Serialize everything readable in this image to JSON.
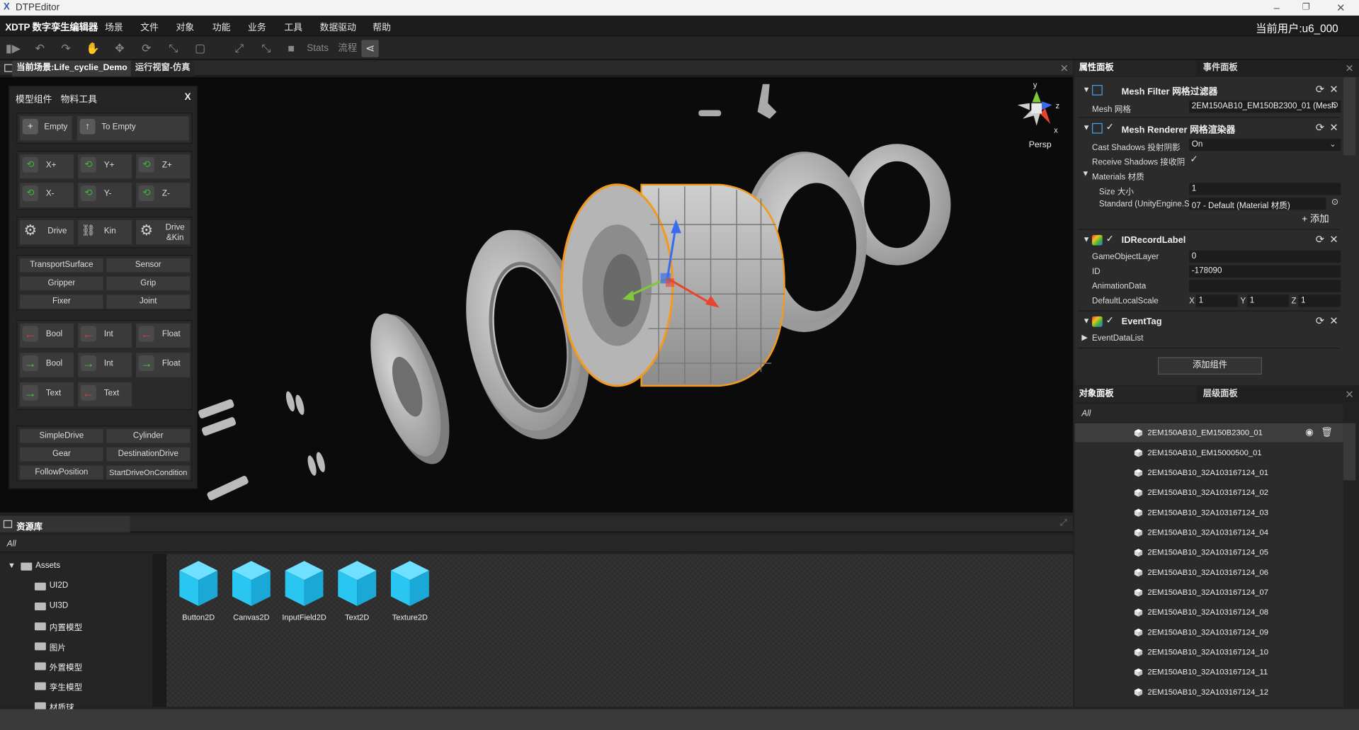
{
  "window": {
    "title": "DTPEditor",
    "logo_text": "X"
  },
  "menubar": {
    "brand": "XDTP 数字孪生编辑器",
    "items": [
      "场景",
      "文件",
      "对象",
      "功能",
      "业务",
      "工具",
      "数据驱动",
      "帮助"
    ],
    "user": "当前用户:u6_000"
  },
  "toolbar": {
    "stats_label": "Stats",
    "flow_label": "流程"
  },
  "scene": {
    "tab_current": "当前场景:Life_cyclie_Demo",
    "tab_runtime": "运行视窗-仿真",
    "view_mode": "Persp",
    "axes": {
      "y": "y",
      "z": "z",
      "x": "x"
    }
  },
  "tool_panel": {
    "tabs": [
      "模型组件",
      "物料工具"
    ],
    "close": "X",
    "empty_buttons": [
      "Empty",
      "To Empty"
    ],
    "axis_buttons": [
      "X+",
      "Y+",
      "Z+",
      "X-",
      "Y-",
      "Z-"
    ],
    "drive_buttons": [
      "Drive",
      "Kin",
      "Drive &Kin"
    ],
    "component_buttons": [
      "TransportSurface",
      "Sensor",
      "Gripper",
      "Grip",
      "Fixer",
      "Joint"
    ],
    "signal_buttons": [
      "Bool",
      "Int",
      "Float",
      "Bool",
      "Int",
      "Float",
      "Text",
      "Text"
    ],
    "drive_types": [
      "SimpleDrive",
      "Cylinder",
      "Gear",
      "DestinationDrive",
      "FollowPosition",
      "StartDriveOnCondition"
    ]
  },
  "properties": {
    "tab_props": "属性面板",
    "tab_events": "事件面板",
    "mesh_filter": {
      "title": "Mesh Filter 网格过滤器",
      "mesh_label": "Mesh 网格",
      "mesh_value": "2EM150AB10_EM150B2300_01 (Mesh"
    },
    "mesh_renderer": {
      "title": "Mesh Renderer 网格渲染器",
      "cast_shadows_label": "Cast Shadows 投射阴影",
      "cast_shadows_value": "On",
      "receive_shadows_label": "Receive Shadows 接收阴",
      "receive_shadows_value": "✓",
      "materials_label": "Materials 材质",
      "size_label": "Size 大小",
      "size_value": "1",
      "standard_label": "Standard (UnityEngine.S",
      "standard_value": "07 - Default (Material 材质)",
      "add_label": "+ 添加"
    },
    "id_record": {
      "title": "IDRecordLabel",
      "layer_label": "GameObjectLayer",
      "layer_value": "0",
      "id_label": "ID",
      "id_value": "-178090",
      "anim_label": "AnimationData",
      "anim_value": "",
      "scale_label": "DefaultLocalScale",
      "scale_x_label": "X",
      "scale_x": "1",
      "scale_y_label": "Y",
      "scale_y": "1",
      "scale_z_label": "Z",
      "scale_z": "1"
    },
    "event_tag": {
      "title": "EventTag",
      "list_label": "EventDataList"
    },
    "add_component": "添加组件"
  },
  "objects": {
    "tab_objects": "对象面板",
    "tab_hierarchy": "层级面板",
    "filter": "All",
    "items": [
      "2EM150AB10_EM150B2300_01",
      "2EM150AB10_EM15000500_01",
      "2EM150AB10_32A103167124_01",
      "2EM150AB10_32A103167124_02",
      "2EM150AB10_32A103167124_03",
      "2EM150AB10_32A103167124_04",
      "2EM150AB10_32A103167124_05",
      "2EM150AB10_32A103167124_06",
      "2EM150AB10_32A103167124_07",
      "2EM150AB10_32A103167124_08",
      "2EM150AB10_32A103167124_09",
      "2EM150AB10_32A103167124_10",
      "2EM150AB10_32A103167124_11",
      "2EM150AB10_32A103167124_12"
    ]
  },
  "assets": {
    "title": "资源库",
    "filter": "All",
    "tree": [
      "Assets",
      "UI2D",
      "UI3D",
      "内置模型",
      "图片",
      "外置模型",
      "孪生模型",
      "材质球"
    ],
    "items": [
      "Button2D",
      "Canvas2D",
      "InputField2D",
      "Text2D",
      "Texture2D"
    ]
  },
  "colors": {
    "accent_cube": "#29c6f2",
    "selection_outline": "#f39a1e",
    "gizmo_x": "#e8452c",
    "gizmo_y": "#3b6cf0",
    "gizmo_z": "#7ec83a"
  }
}
